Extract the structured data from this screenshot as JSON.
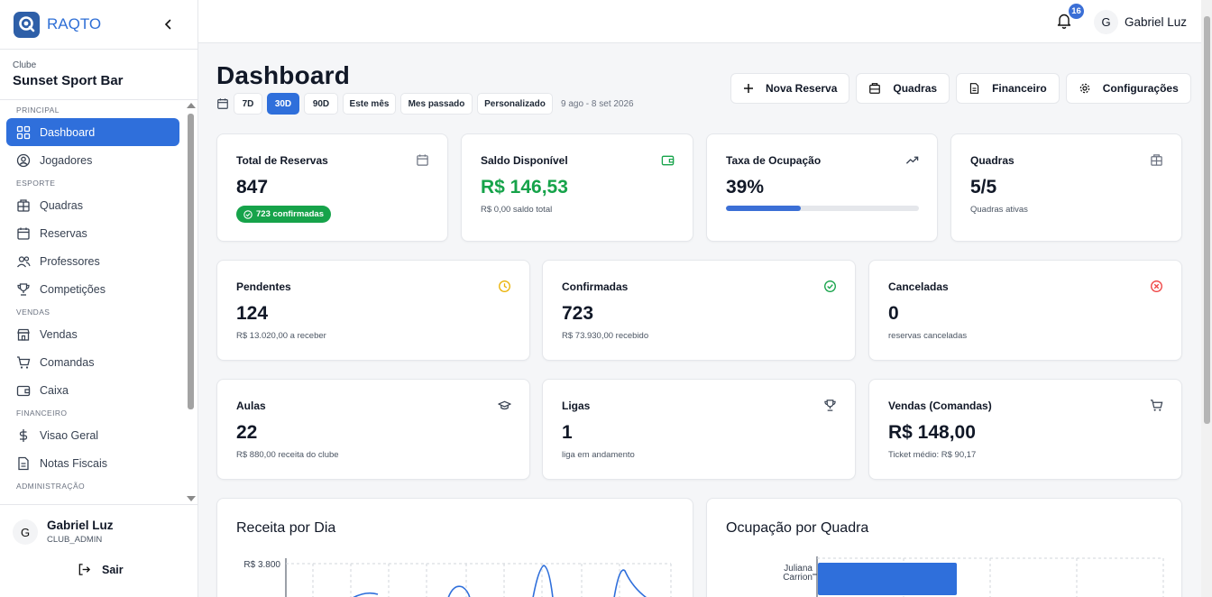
{
  "app": {
    "name": "RAQTO"
  },
  "club": {
    "label": "Clube",
    "name": "Sunset Sport Bar"
  },
  "sidebar": {
    "sections": [
      "PRINCIPAL",
      "ESPORTE",
      "VENDAS",
      "FINANCEIRO",
      "ADMINISTRAÇÃO"
    ],
    "items": [
      {
        "label": "Dashboard",
        "icon": "grid-icon",
        "active": true
      },
      {
        "label": "Jogadores",
        "icon": "user-circle-icon"
      },
      {
        "label": "Quadras",
        "icon": "building-icon"
      },
      {
        "label": "Reservas",
        "icon": "calendar-icon"
      },
      {
        "label": "Professores",
        "icon": "users-icon"
      },
      {
        "label": "Competições",
        "icon": "trophy-icon"
      },
      {
        "label": "Vendas",
        "icon": "store-icon"
      },
      {
        "label": "Comandas",
        "icon": "cart-icon"
      },
      {
        "label": "Caixa",
        "icon": "wallet-icon"
      },
      {
        "label": "Visao Geral",
        "icon": "dollar-icon"
      },
      {
        "label": "Notas Fiscais",
        "icon": "file-icon"
      }
    ]
  },
  "user": {
    "initial": "G",
    "name": "Gabriel Luz",
    "role": "CLUB_ADMIN",
    "logout_label": "Sair"
  },
  "topbar": {
    "notifications": "16",
    "initial": "G",
    "user_name": "Gabriel Luz"
  },
  "page": {
    "title": "Dashboard"
  },
  "filters": {
    "options": [
      "7D",
      "30D",
      "90D",
      "Este mês",
      "Mes passado",
      "Personalizado"
    ],
    "active": "30D",
    "range": "9 ago - 8 set 2026"
  },
  "actions": [
    "Nova Reserva",
    "Quadras",
    "Financeiro",
    "Configurações"
  ],
  "stats": {
    "total_reservas": {
      "title": "Total de Reservas",
      "value": "847",
      "badge": "723 confirmadas"
    },
    "saldo": {
      "title": "Saldo Disponível",
      "value": "R$ 146,53",
      "sub": "R$ 0,00 saldo total"
    },
    "ocupacao": {
      "title": "Taxa de Ocupação",
      "value": "39%",
      "progress": 0.39
    },
    "quadras": {
      "title": "Quadras",
      "value": "5/5",
      "sub": "Quadras ativas"
    },
    "pendentes": {
      "title": "Pendentes",
      "value": "124",
      "sub": "R$ 13.020,00 a receber"
    },
    "confirmadas": {
      "title": "Confirmadas",
      "value": "723",
      "sub": "R$ 73.930,00 recebido"
    },
    "canceladas": {
      "title": "Canceladas",
      "value": "0",
      "sub": "reservas canceladas"
    },
    "aulas": {
      "title": "Aulas",
      "value": "22",
      "sub": "R$ 880,00 receita do clube"
    },
    "ligas": {
      "title": "Ligas",
      "value": "1",
      "sub": "liga em andamento"
    },
    "vendas": {
      "title": "Vendas (Comandas)",
      "value": "R$ 148,00",
      "sub": "Ticket médio: R$ 90,17"
    }
  },
  "colors": {
    "primary": "#2f6fdb",
    "success": "#16a34a",
    "warning": "#eab308",
    "danger": "#ef4444"
  },
  "chart_data": [
    {
      "type": "line",
      "title": "Receita por Dia",
      "ylabel": "",
      "y_tick_labels": [
        "R$ 3.800"
      ],
      "note": "Only the top portion of the chart is visible"
    },
    {
      "type": "bar",
      "title": "Ocupação por Quadra",
      "categories": [
        "Juliana Carrion"
      ],
      "orientation": "horizontal"
    }
  ]
}
